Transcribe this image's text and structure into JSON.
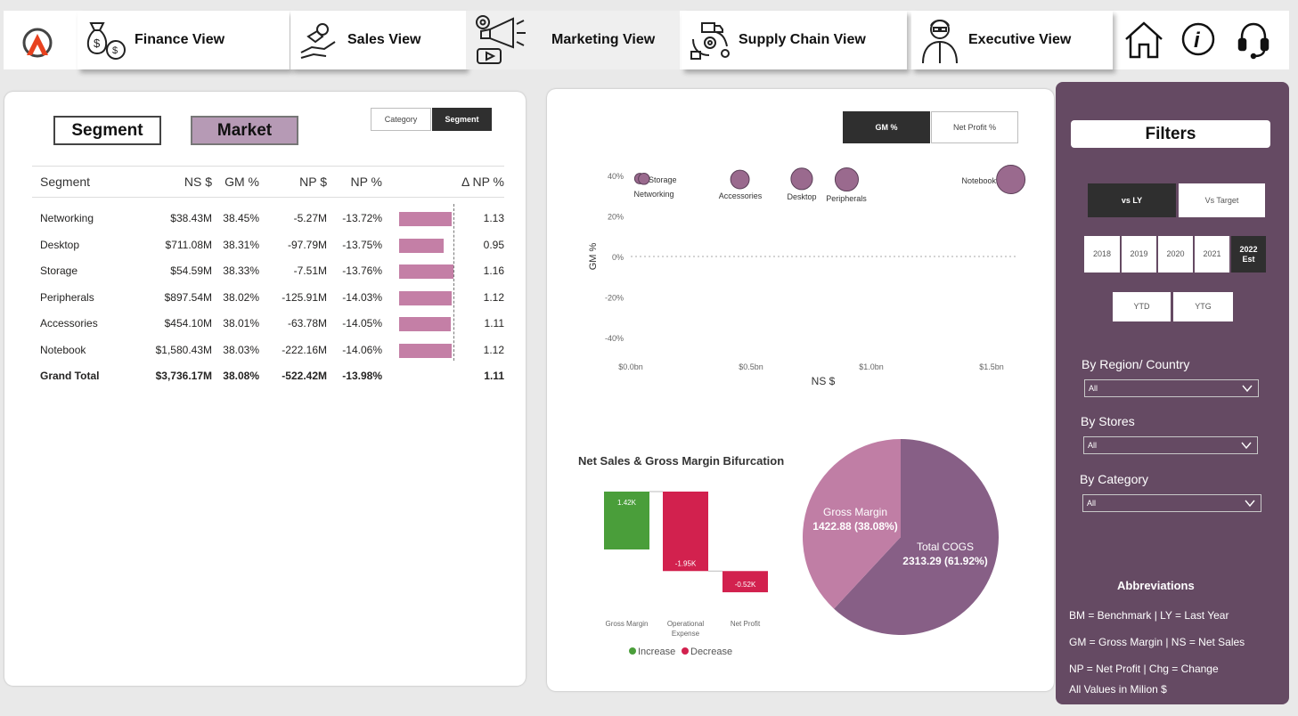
{
  "nav": {
    "tabs": [
      {
        "label": "Finance View",
        "icon": "money-bag-icon"
      },
      {
        "label": "Sales View",
        "icon": "sales-hand-icon"
      },
      {
        "label": "Marketing View",
        "icon": "megaphone-icon"
      },
      {
        "label": "Supply Chain View",
        "icon": "supply-chain-icon"
      },
      {
        "label": "Executive View",
        "icon": "executive-icon"
      }
    ],
    "active": "Marketing View",
    "right_icons": [
      "home-icon",
      "info-icon",
      "headset-icon"
    ]
  },
  "left": {
    "buttons": {
      "segment": "Segment",
      "market": "Market"
    },
    "toggle": {
      "category": "Category",
      "segment": "Segment"
    },
    "table": {
      "headers": [
        "Segment",
        "NS $",
        "GM %",
        "NP $",
        "NP %",
        "Δ NP %"
      ],
      "rows": [
        {
          "segment": "Networking",
          "ns": "$38.43M",
          "gm": "38.45%",
          "np": "-5.27M",
          "npp": "-13.72%",
          "delta": "1.13",
          "delta_value": 1.13
        },
        {
          "segment": "Desktop",
          "ns": "$711.08M",
          "gm": "38.31%",
          "np": "-97.79M",
          "npp": "-13.75%",
          "delta": "0.95",
          "delta_value": 0.95
        },
        {
          "segment": "Storage",
          "ns": "$54.59M",
          "gm": "38.33%",
          "np": "-7.51M",
          "npp": "-13.76%",
          "delta": "1.16",
          "delta_value": 1.16
        },
        {
          "segment": "Peripherals",
          "ns": "$897.54M",
          "gm": "38.02%",
          "np": "-125.91M",
          "npp": "-14.03%",
          "delta": "1.12",
          "delta_value": 1.12
        },
        {
          "segment": "Accessories",
          "ns": "$454.10M",
          "gm": "38.01%",
          "np": "-63.78M",
          "npp": "-14.05%",
          "delta": "1.11",
          "delta_value": 1.11
        },
        {
          "segment": "Notebook",
          "ns": "$1,580.43M",
          "gm": "38.03%",
          "np": "-222.16M",
          "npp": "-14.06%",
          "delta": "1.12",
          "delta_value": 1.12
        }
      ],
      "total": {
        "segment": "Grand Total",
        "ns": "$3,736.17M",
        "gm": "38.08%",
        "np": "-522.42M",
        "npp": "-13.98%",
        "delta": "1.11"
      }
    }
  },
  "mid": {
    "toggle": {
      "gm": "GM %",
      "np": "Net Profit %"
    },
    "waterfall_title": "Net Sales & Gross Margin Bifurcation",
    "legend": {
      "increase": "Increase",
      "decrease": "Decrease"
    }
  },
  "chart_data": [
    {
      "type": "scatter",
      "xlabel": "NS $",
      "ylabel": "GM %",
      "xticks": [
        "$0.0bn",
        "$0.5bn",
        "$1.0bn",
        "$1.5bn"
      ],
      "yticks": [
        "40%",
        "20%",
        "0%",
        "-20%",
        "-40%"
      ],
      "xlim": [
        0,
        1.6
      ],
      "ylim": [
        -40,
        40
      ],
      "points": [
        {
          "label": "Networking",
          "x": 0.038,
          "y": 38.45
        },
        {
          "label": "Storage",
          "x": 0.055,
          "y": 38.33
        },
        {
          "label": "Accessories",
          "x": 0.454,
          "y": 38.01
        },
        {
          "label": "Desktop",
          "x": 0.711,
          "y": 38.31
        },
        {
          "label": "Peripherals",
          "x": 0.898,
          "y": 38.02
        },
        {
          "label": "Notebook",
          "x": 1.58,
          "y": 38.03
        }
      ],
      "color": "#9a6a8e"
    },
    {
      "type": "bar",
      "subtype": "waterfall",
      "title": "Net Sales & Gross Margin Bifurcation",
      "categories": [
        "Gross Margin",
        "Operational Expense",
        "Net Profit"
      ],
      "values": [
        1.42,
        -1.95,
        -0.52
      ],
      "labels": [
        "1.42K",
        "-1.95K",
        "-0.52K"
      ],
      "colors": {
        "increase": "#4a9e3a",
        "decrease": "#d2214e"
      }
    },
    {
      "type": "pie",
      "slices": [
        {
          "label": "Total COGS",
          "value": 2313.29,
          "text": "2313.29 (61.92%)",
          "color": "#875f86"
        },
        {
          "label": "Gross Margin",
          "value": 1422.88,
          "text": "1422.88 (38.08%)",
          "color": "#c07ea5"
        }
      ]
    }
  ],
  "filters": {
    "title": "Filters",
    "compare": [
      "vs LY",
      "Vs Target"
    ],
    "compare_selected": "vs LY",
    "years": [
      "2018",
      "2019",
      "2020",
      "2021",
      "2022 Est"
    ],
    "year_selected": "2022 Est",
    "periods": [
      "YTD",
      "YTG"
    ],
    "dropdowns": [
      {
        "label": "By Region/ Country",
        "value": "All"
      },
      {
        "label": "By Stores",
        "value": "All"
      },
      {
        "label": "By Category",
        "value": "All"
      }
    ],
    "abbr_title": "Abbreviations",
    "abbr": [
      "BM = Benchmark | LY = Last Year",
      "GM = Gross Margin | NS = Net Sales",
      "NP = Net Profit | Chg = Change",
      "All Values in Milion $"
    ]
  },
  "colors": {
    "accent": "#654a63",
    "bar": "#c47fa6",
    "button_market": "#b69ab5"
  }
}
